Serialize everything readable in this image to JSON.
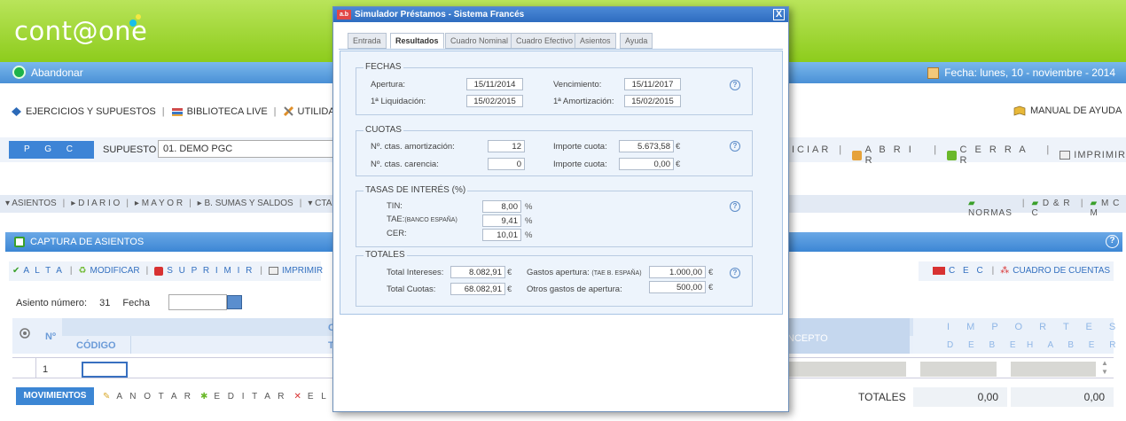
{
  "header": {
    "logo": "cont@one"
  },
  "topbar": {
    "abandon": "Abandonar",
    "date": "Fecha:  lunes, 10 - noviembre - 2014"
  },
  "menu": {
    "ejercicios": "EJERCICIOS Y SUPUESTOS",
    "biblioteca": "BIBLIOTECA LIVE",
    "utilidades": "UTILIDADE",
    "manual": "MANUAL DE AYUDA"
  },
  "pgc_row": {
    "pgc": "P G C",
    "supuesto_label": "SUPUESTO",
    "supuesto_value": "01. DEMO PGC",
    "iniciar": "NICIAR",
    "abrir": "A B R I R",
    "cerrar": "C E R R A R",
    "imprimir": "IMPRIMIR"
  },
  "tabs_left": [
    "ASIENTOS",
    "D I A R I O",
    "M A Y O R",
    "B. SUMAS Y SALDOS",
    "CTA"
  ],
  "tabs_right": [
    "NORMAS",
    "D & R C",
    "M C M"
  ],
  "captura": {
    "title": "CAPTURA DE ASIENTOS",
    "help": "?"
  },
  "asiento_actions": {
    "alta": "A L T A",
    "modificar": "MODIFICAR",
    "suprimir": "S U P R I M I R",
    "imprimir": "IMPRIMIR"
  },
  "right_actions": {
    "cec": "C E C",
    "cuadro": "CUADRO DE CUENTAS"
  },
  "asiento": {
    "numero_label": "Asiento número:",
    "numero": "31",
    "fecha_label": "Fecha"
  },
  "grid": {
    "n": "Nº",
    "codigo": "CÓDIGO",
    "concepto": "NCEPTO",
    "importes": "I M P O R T E S",
    "debe": "D E B E",
    "haber": "H A B E R",
    "row_number": "1",
    "header_cut_top": "C",
    "header_cut_bottom": "T"
  },
  "bottom": {
    "movimientos": "MOVIMIENTOS",
    "anotar": "A N O T A R",
    "editar": "E D I T A R",
    "eliminar": "E L I M I N A",
    "totales_label": "TOTALES",
    "total_debe": "0,00",
    "total_haber": "0,00"
  },
  "dialog": {
    "title": "Simulador Préstamos - Sistema Francés",
    "icon_text": "a.b",
    "close": "X",
    "tabs": [
      "Entrada",
      "Resultados",
      "Cuadro Nominal",
      "Cuadro Efectivo",
      "Asientos",
      "Ayuda"
    ],
    "active_tab": "Resultados",
    "fechas": {
      "legend": "FECHAS",
      "apertura_label": "Apertura:",
      "apertura": "15/11/2014",
      "vencimiento_label": "Vencimiento:",
      "vencimiento": "15/11/2017",
      "liquidacion_label": "1ª Liquidación:",
      "liquidacion": "15/02/2015",
      "amortizacion_label": "1ª Amortización:",
      "amortizacion": "15/02/2015"
    },
    "cuotas": {
      "legend": "CUOTAS",
      "n_amort_label": "Nº. ctas. amortización:",
      "n_amort": "12",
      "importe_label": "Importe cuota:",
      "importe": "5.673,58",
      "n_carencia_label": "Nº. ctas. carencia:",
      "n_carencia": "0",
      "importe2_label": "Importe cuota:",
      "importe2": "0,00",
      "currency": "€"
    },
    "tasas": {
      "legend": "TASAS DE INTERÉS (%)",
      "tin_label": "TIN:",
      "tin": "8,00",
      "tae_label": "TAE:",
      "tae_sub": "(BANCO ESPAÑA)",
      "tae": "9,41",
      "cer_label": "CER:",
      "cer": "10,01",
      "pct": "%"
    },
    "totales": {
      "legend": "TOTALES",
      "intereses_label": "Total Intereses:",
      "intereses": "8.082,91",
      "cuotas_label": "Total Cuotas:",
      "cuotas": "68.082,91",
      "gastos_label": "Gastos apertura:",
      "gastos_sub": "(TAE B. ESPAÑA)",
      "gastos": "1.000,00",
      "otros_label": "Otros gastos de apertura:",
      "otros": "500,00",
      "currency": "€"
    },
    "help": "?"
  },
  "colors": {
    "header_green": "#8dcc1c",
    "bar_blue": "#4a90d6",
    "dialog_blue": "#2e6cc0",
    "panel_bg": "#edf4fc"
  }
}
